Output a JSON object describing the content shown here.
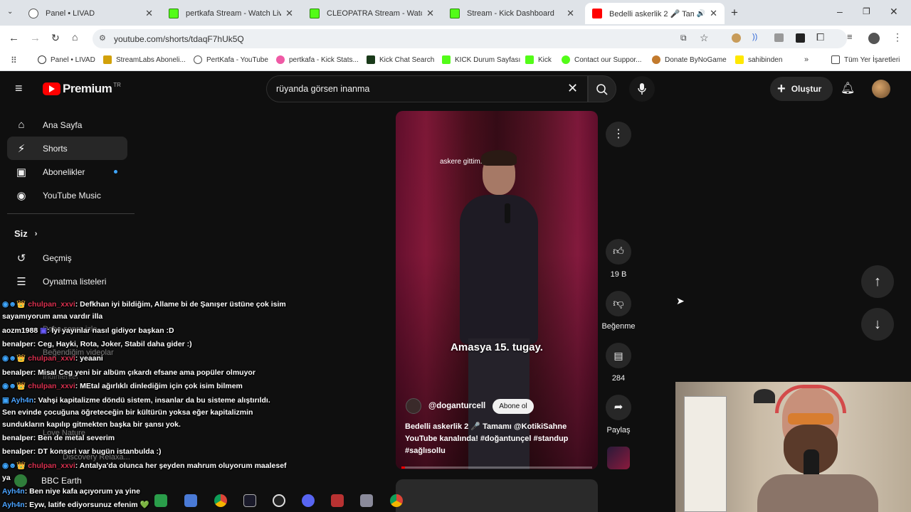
{
  "tabs": [
    {
      "title": "Panel • LIVAD",
      "active": false
    },
    {
      "title": "pertkafa Stream - Watch Live o",
      "active": false
    },
    {
      "title": "CLEOPATRA Stream - Watch Live",
      "active": false
    },
    {
      "title": "Stream - Kick Dashboard",
      "active": false
    },
    {
      "title": "Bedelli askerlik 2 🎤 Tamam",
      "active": true
    }
  ],
  "address": {
    "url": "youtube.com/shorts/tdaqF7hUk5Q"
  },
  "bookmarks": [
    "Panel • LIVAD",
    "StreamLabs Aboneli...",
    "PertKafa - YouTube",
    "pertkafa - Kick Stats...",
    "Kick Chat Search",
    "KICK Durum Sayfası",
    "Kick",
    "Contact our Suppor...",
    "Donate ByNoGame",
    "sahibinden",
    "Tüm Yer İşaretleri"
  ],
  "youtube": {
    "logo_text": "Premium",
    "logo_region": "TR",
    "search_value": "rüyanda görsen inanma",
    "create_label": "Oluştur",
    "sidebar": [
      {
        "label": "Ana Sayfa",
        "icon": "home-icon"
      },
      {
        "label": "Shorts",
        "icon": "shorts-icon"
      },
      {
        "label": "Abonelikler",
        "icon": "subscriptions-icon"
      },
      {
        "label": "YouTube Music",
        "icon": "music-icon"
      }
    ],
    "sidebar_you": "Siz",
    "sidebar2": [
      {
        "label": "Geçmiş",
        "icon": "history-icon"
      },
      {
        "label": "Oynatma listeleri",
        "icon": "playlist-icon"
      }
    ],
    "sidebar_hidden": [
      "Daha sonra izle",
      "Beğendiğim videolar",
      "İndirilenler",
      "Love Nature",
      "Discovery Relaxa...",
      "BBC Earth"
    ]
  },
  "short": {
    "caption_top": "askere gittim.",
    "caption_main": "Amasya 15. tugay.",
    "channel": "@doganturcell",
    "subscribe_label": "Abone ol",
    "desc_line1": "Bedelli askerlik 2 🎤 Tamamı @KotikiSahne",
    "desc_line2": "YouTube kanalında! #doğantunçel #standup",
    "desc_line3": "#sağlısollu",
    "likes": "19 B",
    "dislike_label": "Beğenme",
    "comments": "284",
    "share_label": "Paylaş",
    "progress": 0.02
  },
  "chat": [
    {
      "user": "chulpan_xxvi",
      "text": ": Defkhan iyi bildiğim, Allame bi de Şanışer üstüne çok isim",
      "cont": "sayamıyorum ama vardır illa",
      "color": "u1"
    },
    {
      "user": "aozm1988",
      "text": ": İyi yayınlar nasıl gidiyor başkan :D",
      "color": "u4"
    },
    {
      "user": "benalper",
      "text": ": Ceg, Hayki, Rota, Joker, Stabil daha gider :)",
      "color": "u4"
    },
    {
      "user": "chulpan_xxvi",
      "text": ": yeaani",
      "color": "u1"
    },
    {
      "user": "benalper",
      "text": ": Misal Ceg yeni bir albüm çıkardı efsane ama popüler olmuyor",
      "color": "u4"
    },
    {
      "user": "chulpan_xxvi",
      "text": ": MEtal ağırlıklı dinlediğim için çok isim bilmem",
      "color": "u1"
    },
    {
      "user": "Ayh4n",
      "text": ": Vahşi kapitalizme döndü sistem, insanlar da bu sisteme alıştırıldı.",
      "cont": "Sen evinde çocuğuna öğreteceğin bir kültürün yoksa eğer kapitalizmin",
      "cont2": "sundukların kapılıp gitmekten başka bir şansı yok.",
      "color": "u3"
    },
    {
      "user": "benalper",
      "text": ": Ben de metal severim",
      "color": "u4"
    },
    {
      "user": "benalper",
      "text": ": DT konseri var bugün istanbulda :)",
      "color": "u4"
    },
    {
      "user": "chulpan_xxvi",
      "text": ": Antalya'da olunca her şeyden mahrum oluyorum maalesef",
      "cont": "ya",
      "color": "u1"
    },
    {
      "user": "Ayh4n",
      "text": ": Ben niye kafa açıyorum ya yine",
      "color": "u3"
    },
    {
      "user": "Ayh4n",
      "text": ": Eyw, latife ediyorsunuz efenim 💚",
      "color": "u3"
    }
  ]
}
